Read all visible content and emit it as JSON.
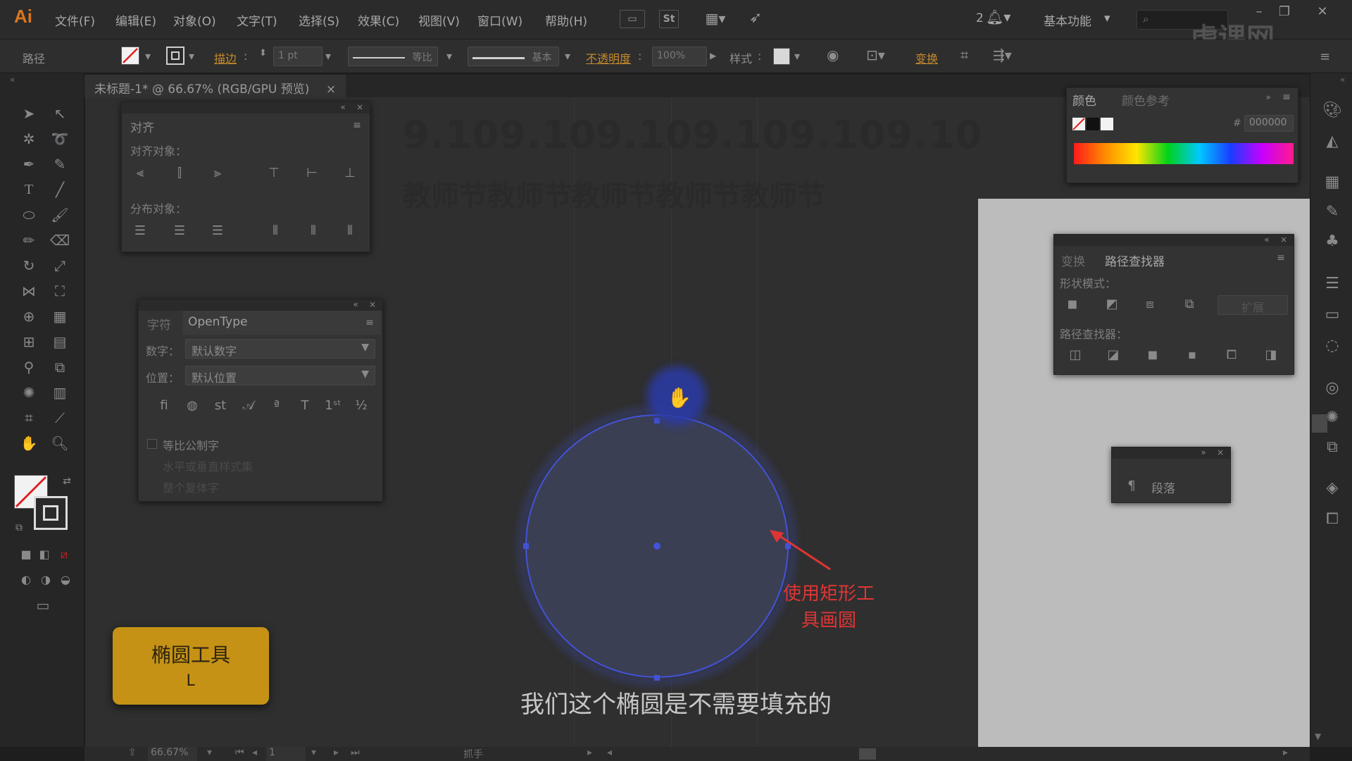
{
  "app": {
    "logo": "Ai"
  },
  "menu": [
    "文件(F)",
    "编辑(E)",
    "对象(O)",
    "文字(T)",
    "选择(S)",
    "效果(C)",
    "视图(V)",
    "窗口(W)",
    "帮助(H)"
  ],
  "menubar_right": {
    "st_label": "St",
    "notif_count": "2",
    "workspace": "基本功能"
  },
  "watermark": "虎课网",
  "controlbar": {
    "selection_label": "路径",
    "stroke_label": "描边",
    "stroke_weight": "1 pt",
    "profile_label": "等比",
    "brush_label": "基本",
    "opacity_label": "不透明度",
    "opacity_value": "100%",
    "style_label": "样式",
    "transform_label": "变换"
  },
  "document_tab": {
    "title": "未标题-1* @ 66.67% (RGB/GPU 预览)",
    "close": "×"
  },
  "artboard_text": {
    "line1": "9.109.109.109.109.109.10",
    "line2": "教师节教师节教师节教师节教师节"
  },
  "align_panel": {
    "title": "对齐",
    "align_objects_label": "对齐对象：",
    "distribute_objects_label": "分布对象："
  },
  "opentype_panel": {
    "tab_char": "字符",
    "tab_opentype": "OpenType",
    "number_label": "数字：",
    "number_value": "默认数字",
    "position_label": "位置：",
    "position_value": "默认位置",
    "proportional_label": "等比公制字",
    "option2": "水平或垂直样式集",
    "option3": "整个复体字"
  },
  "color_panel": {
    "tab_color": "颜色",
    "tab_guide": "颜色参考",
    "hex_value": "000000"
  },
  "pathfinder_panel": {
    "tab_transform": "变换",
    "tab_pathfinder": "路径查找器",
    "shape_modes_label": "形状模式：",
    "expand_label": "扩展",
    "pathfinders_label": "路径查找器："
  },
  "paragraph_panel": {
    "label": "段落"
  },
  "statusbar": {
    "zoom": "66.67%",
    "page": "1",
    "tool_name": "抓手"
  },
  "tool_badge": {
    "name": "椭圆工具",
    "shortcut": "L"
  },
  "annotation": "使用矩形工具画圆",
  "subtitle": "我们这个椭圆是不需要填充的",
  "colors": {
    "badge": "#c59215",
    "annotation": "#e03535",
    "ellipse_fill": "#3b3f54",
    "selection": "#4353d8"
  }
}
